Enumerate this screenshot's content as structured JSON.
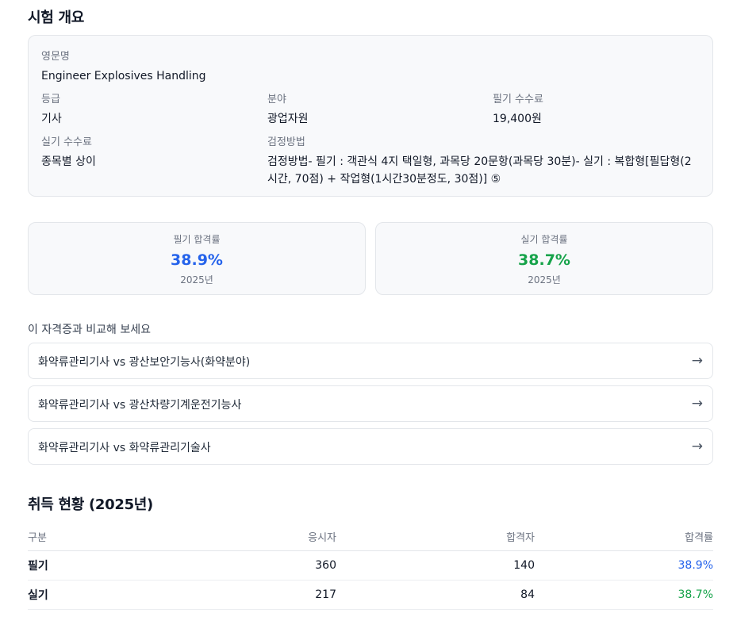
{
  "overview": {
    "title": "시험 개요",
    "english_name": {
      "label": "영문명",
      "value": "Engineer Explosives Handling"
    },
    "grade": {
      "label": "등급",
      "value": "기사"
    },
    "field": {
      "label": "분야",
      "value": "광업자원"
    },
    "written_fee": {
      "label": "필기 수수료",
      "value": "19,400원"
    },
    "practical_fee": {
      "label": "실기 수수료",
      "value": "종목별 상이"
    },
    "method": {
      "label": "검정방법",
      "value": "검정방법- 필기 : 객관식 4지 택일형, 과목당 20문항(과목당 30분)- 실기 : 복합형[필답형(2시간, 70점) + 작업형(1시간30분정도, 30점)] ⑤"
    }
  },
  "pass_rates": {
    "written": {
      "label": "필기 합격률",
      "value": "38.9%",
      "year": "2025년",
      "color": "#2563eb"
    },
    "practical": {
      "label": "실기 합격률",
      "value": "38.7%",
      "year": "2025년",
      "color": "#16a34a"
    }
  },
  "compare": {
    "title": "이 자격증과 비교해 보세요",
    "arrow": "→",
    "items": [
      {
        "label": "화약류관리기사 vs 광산보안기능사(화약분야)"
      },
      {
        "label": "화약류관리기사 vs 광산차량기계운전기능사"
      },
      {
        "label": "화약류관리기사 vs 화약류관리기술사"
      }
    ]
  },
  "stats": {
    "title": "취득 현황 (2025년)",
    "columns": [
      "구분",
      "응시자",
      "합격자",
      "합격률"
    ],
    "rows": [
      {
        "type": "필기",
        "applicants": "360",
        "passed": "140",
        "rate": "38.9%"
      },
      {
        "type": "실기",
        "applicants": "217",
        "passed": "84",
        "rate": "38.7%"
      }
    ]
  }
}
